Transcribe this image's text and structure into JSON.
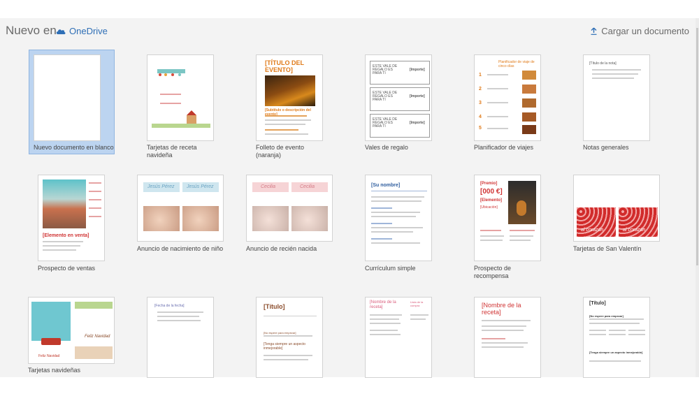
{
  "header": {
    "title": "Nuevo en",
    "location": "OneDrive",
    "upload_label": "Cargar un documento"
  },
  "icons": {
    "onedrive": "cloud-icon",
    "upload": "upload-arrow-icon"
  },
  "colors": {
    "selection": "#bcd4f0",
    "onedrive_blue": "#2f6fb6",
    "accent_orange": "#e07b1a",
    "accent_red": "#d03434"
  },
  "templates": [
    {
      "label": "Nuevo documento en blanco",
      "selected": true
    },
    {
      "label": "Tarjetas de receta navideña"
    },
    {
      "label": "Folleto de evento (naranja)"
    },
    {
      "label": "Vales de regalo"
    },
    {
      "label": "Planificador de viajes"
    },
    {
      "label": "Notas generales"
    },
    {
      "label": "Prospecto de ventas"
    },
    {
      "label": "Anuncio de nacimiento de niño"
    },
    {
      "label": "Anuncio de recién nacida"
    },
    {
      "label": "Currículum simple"
    },
    {
      "label": "Prospecto de recompensa"
    },
    {
      "label": "Tarjetas de San Valentín"
    },
    {
      "label": "Tarjetas navideñas"
    }
  ],
  "thumb_text": {
    "evento_title": "[TÍTULO DEL EVENTO]",
    "evento_sub": "[Subtítulo o descripción del evento]",
    "vale_text": "ESTE VALE DE REGALO ES PARA TI",
    "vale_amount": "[Importe]",
    "viajes_title": "Planificador de viaje de cinco días",
    "viajes_days": [
      "1",
      "2",
      "3",
      "4",
      "5"
    ],
    "notas_title": "[Título de la nota]",
    "ventas_item": "[Elemento en venta]",
    "boy_name": "Jesús Pérez",
    "girl_name": "Cecilia",
    "cv_name": "[Su nombre]",
    "premio": "[Premio]",
    "amount": "[000 €]",
    "elemento": "[Elemento]",
    "ubicacion": "[Ubicación]",
    "valentin": "al corazón",
    "navidad": "Feliz Navidad",
    "fecha": "[Fecha de la fecha]",
    "titulo": "[Título]",
    "receta": "[Nombre de la receta]",
    "receta_side": "Lista de la compra",
    "aspecto": "[Tenga siempre un aspecto inmejorable]",
    "empezar": "[No espere para empezar]"
  }
}
